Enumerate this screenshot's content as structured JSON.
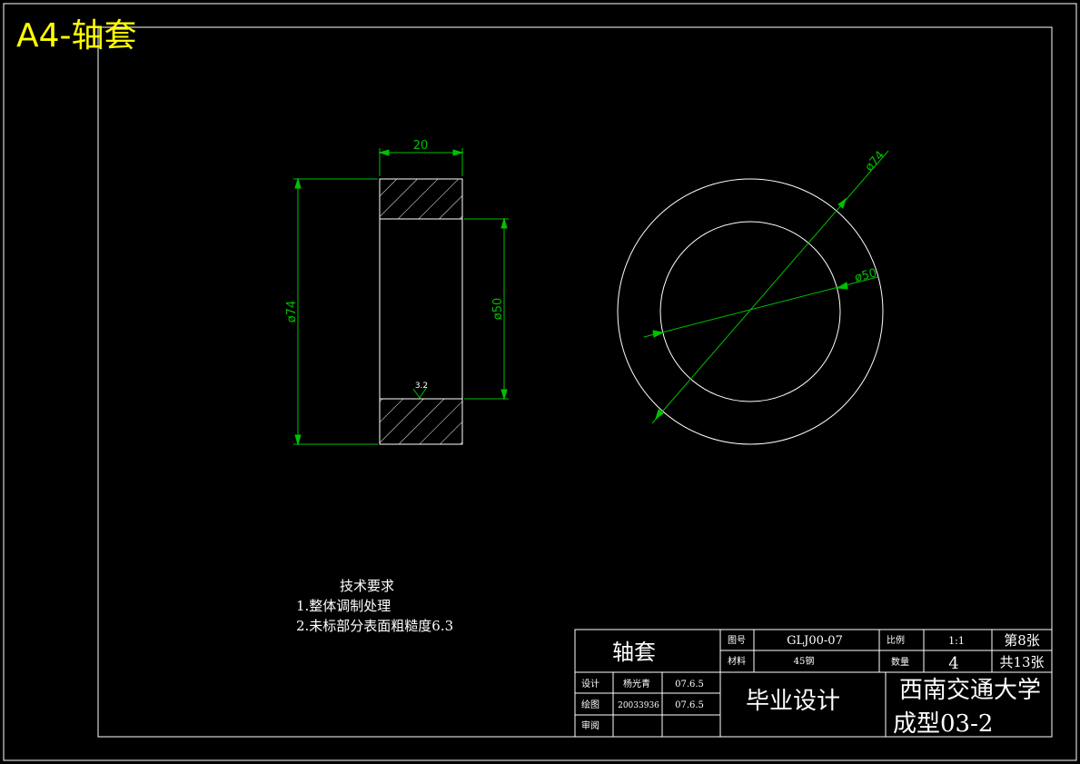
{
  "page_label": "A4-轴套",
  "dimensions": {
    "width": "20",
    "outer_dia_left": "ø74",
    "inner_dia_left": "ø50",
    "roughness": "3.2",
    "outer_dia_right": "ø74",
    "inner_dia_right": "ø50"
  },
  "tech_notes": {
    "title": "技术要求",
    "items": [
      "1.整体调制处理",
      "2.未标部分表面粗糙度6.3"
    ]
  },
  "title_block": {
    "part_name": "轴套",
    "drawing_no_label": "图号",
    "drawing_no": "GLJ00-07",
    "scale_label": "比例",
    "scale": "1:1",
    "sheet_no": "第8张",
    "material_label": "材料",
    "material": "45钢",
    "quantity_label": "数量",
    "quantity": "4",
    "total_sheets": "共13张",
    "design_label": "设计",
    "designer": "杨光青",
    "design_date": "07.6.5",
    "draw_label": "绘图",
    "draw_id": "20033936",
    "draw_date": "07.6.5",
    "review_label": "审阅",
    "project": "毕业设计",
    "school": "西南交通大学",
    "class": "成型03-2"
  }
}
